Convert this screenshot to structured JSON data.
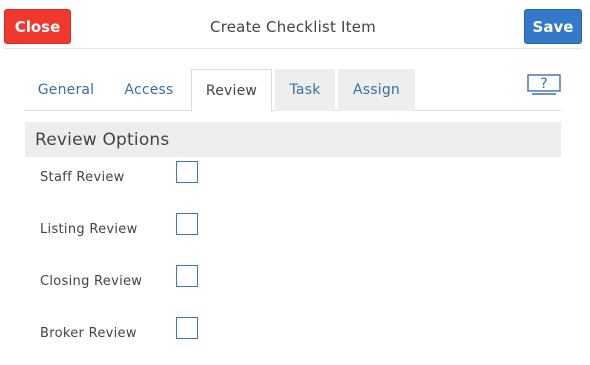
{
  "header": {
    "close_label": "Close",
    "title": "Create Checklist Item",
    "save_label": "Save"
  },
  "tabs": [
    {
      "label": "General",
      "state": "inactive"
    },
    {
      "label": "Access",
      "state": "inactive"
    },
    {
      "label": "Review",
      "state": "active"
    },
    {
      "label": "Task",
      "state": "inactive-shaded"
    },
    {
      "label": "Assign",
      "state": "inactive-shaded"
    }
  ],
  "help": {
    "icon": "help-monitor-icon",
    "glyph": "?"
  },
  "review_options": {
    "heading": "Review Options",
    "items": [
      {
        "label": "Staff Review",
        "checked": false
      },
      {
        "label": "Listing Review",
        "checked": false
      },
      {
        "label": "Closing Review",
        "checked": false
      },
      {
        "label": "Broker Review",
        "checked": false
      }
    ]
  },
  "colors": {
    "close": "#f0382f",
    "save": "#3478c8",
    "link": "#3a6ea5",
    "section_bg": "#ededed"
  }
}
